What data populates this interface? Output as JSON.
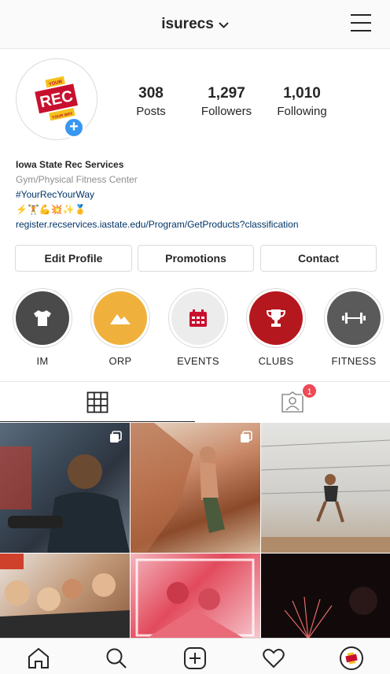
{
  "header": {
    "username": "isurecs"
  },
  "profile": {
    "avatar_text_top": "YOUR",
    "avatar_text_main": "REC",
    "avatar_text_bottom": "YOUR WAY",
    "stats": [
      {
        "value": "308",
        "label": "Posts"
      },
      {
        "value": "1,297",
        "label": "Followers"
      },
      {
        "value": "1,010",
        "label": "Following"
      }
    ],
    "name": "Iowa State Rec Services",
    "category": "Gym/Physical Fitness Center",
    "hashtag": "#YourRecYourWay",
    "emoji_line": "⚡️🏋💪💥✨🥇",
    "link": "register.recservices.iastate.edu/Program/GetProducts?classification"
  },
  "buttons": {
    "edit": "Edit Profile",
    "promotions": "Promotions",
    "contact": "Contact"
  },
  "highlights": [
    {
      "label": "IM",
      "color": "#4a4a4a",
      "icon": "tshirt-icon"
    },
    {
      "label": "ORP",
      "color": "#f0b13c",
      "icon": "mountain-icon"
    },
    {
      "label": "EVENTS",
      "color": "#ececec",
      "icon": "calendar-icon"
    },
    {
      "label": "CLUBS",
      "color": "#b5171e",
      "icon": "trophy-icon"
    },
    {
      "label": "FITNESS",
      "color": "#5a5a5a",
      "icon": "dumbbell-icon"
    }
  ],
  "tabs": {
    "tagged_count": "1"
  },
  "colors": {
    "accent_blue": "#3897f0",
    "notification_red": "#ed4956",
    "link_navy": "#003569"
  }
}
